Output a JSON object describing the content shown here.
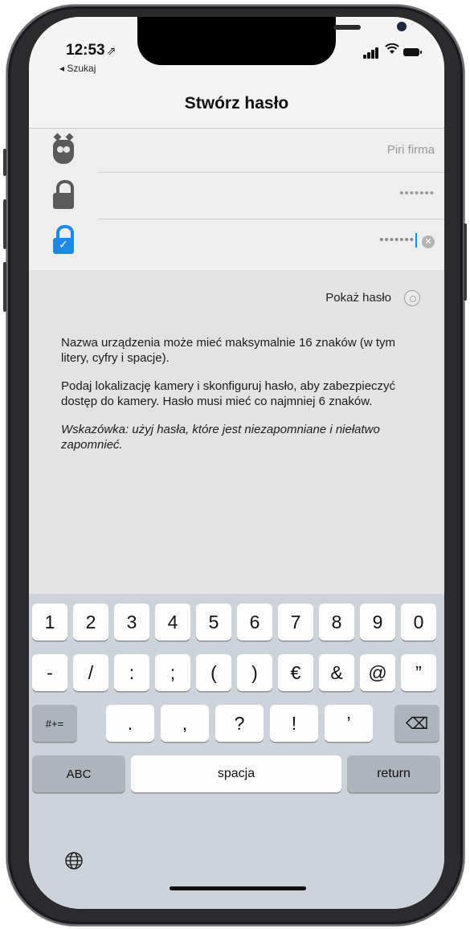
{
  "status_bar": {
    "time": "12:53",
    "location_arrow": "⇗",
    "back_label": "◂ Szukaj"
  },
  "nav": {
    "title": "Stwórz hasło"
  },
  "form": {
    "name_field": {
      "icon": "owl-icon",
      "placeholder": "Piri firma"
    },
    "password_field": {
      "icon": "lock-icon",
      "value": "•••••••"
    },
    "confirm_field": {
      "icon": "lock-check-icon",
      "value": "•••••••"
    }
  },
  "show_password": {
    "label": "Pokaż hasło"
  },
  "description": {
    "p1": "Nazwa urządzenia może mieć maksymalnie 16 znaków (w tym litery, cyfry i spacje).",
    "p2": "Podaj lokalizację kamery i skonfiguruj hasło, aby zabezpieczyć dostęp do kamery. Hasło musi mieć co najmniej 6 znaków.",
    "hint_label": "Wskazówka:",
    "hint_text": " użyj hasła, które jest niezapomniane i niełatwo zapomnieć."
  },
  "keyboard": {
    "row1": [
      "1",
      "2",
      "3",
      "4",
      "5",
      "6",
      "7",
      "8",
      "9",
      "0"
    ],
    "row2": [
      "-",
      "/",
      ":",
      ";",
      "(",
      ")",
      "€",
      "&",
      "@",
      "”"
    ],
    "symbols_key": "#+=",
    "row3": [
      ".",
      ",",
      "?",
      "!",
      "’"
    ],
    "delete_icon": "⌫",
    "abc_key": "ABC",
    "space_key": "spacja",
    "return_key": "return"
  },
  "colors": {
    "accent": "#1e88e5",
    "icon_gray": "#5a5a5a",
    "keyboard_bg": "#cdd3da"
  }
}
